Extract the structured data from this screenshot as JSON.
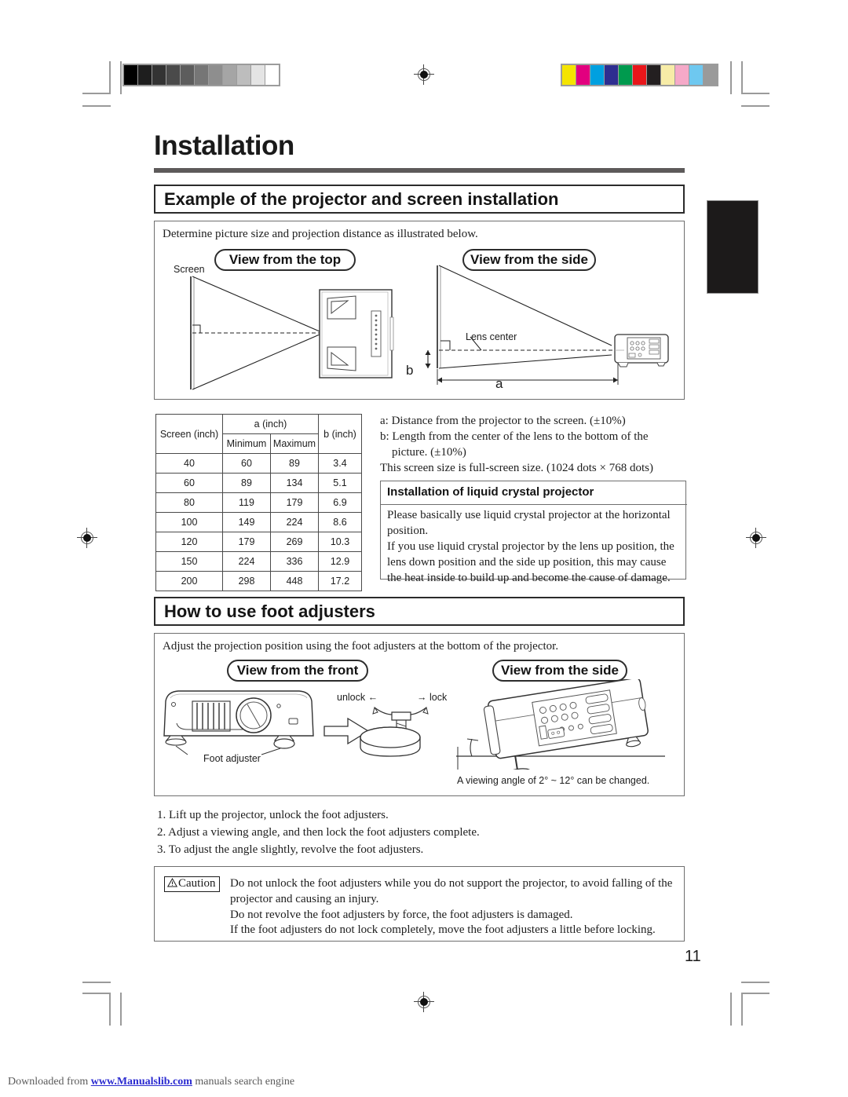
{
  "document": {
    "chapter_title": "Installation",
    "page_number": "11"
  },
  "sections": [
    {
      "id": "example-installation",
      "heading": "Example of the projector and screen installation",
      "intro": "Determine picture size and projection distance as illustrated below.",
      "captions": {
        "view_top": "View from the top",
        "view_side": "View from the side"
      },
      "diagram_labels": {
        "screen": "Screen",
        "lens_center": "Lens center",
        "dim_a": "a",
        "dim_b": "b"
      }
    },
    {
      "id": "foot-adjusters",
      "heading": "How to use foot adjusters",
      "intro": "Adjust the projection position using the foot adjusters at the bottom of the projector.",
      "captions": {
        "view_front": "View from the front",
        "view_side": "View from the side"
      },
      "diagram_labels": {
        "foot_adjuster": "Foot adjuster",
        "unlock": "unlock ←",
        "lock": "→ lock",
        "viewing_angle_note": "A viewing angle of 2° ~ 12° can be changed."
      },
      "steps": [
        "1. Lift up the projector, unlock the foot adjusters.",
        "2. Adjust a viewing angle, and then lock the foot adjusters complete.",
        "3. To adjust the angle slightly, revolve the foot adjusters."
      ]
    }
  ],
  "spec_table": {
    "header_group": "a (inch)",
    "columns": [
      "Screen (inch)",
      "Minimum",
      "Maximum",
      "b (inch)"
    ],
    "rows": [
      [
        "40",
        "60",
        "89",
        "3.4"
      ],
      [
        "60",
        "89",
        "134",
        "5.1"
      ],
      [
        "80",
        "119",
        "179",
        "6.9"
      ],
      [
        "100",
        "149",
        "224",
        "8.6"
      ],
      [
        "120",
        "179",
        "269",
        "10.3"
      ],
      [
        "150",
        "224",
        "336",
        "12.9"
      ],
      [
        "200",
        "298",
        "448",
        "17.2"
      ]
    ]
  },
  "legend_notes": [
    "a: Distance from the projector to the screen. (±10%)",
    "b: Length from the center of the lens to the bottom of the",
    "    picture. (±10%)",
    "This screen size is full-screen size. (1024 dots × 768 dots)"
  ],
  "lcd_box": {
    "heading": "Installation of liquid crystal projector",
    "paragraphs": [
      "Please basically use liquid crystal projector at the horizontal position.",
      "If you use liquid crystal projector by the lens up position, the lens down position and the side up position, this may cause the heat inside to build up and become the cause of damage."
    ]
  },
  "caution": {
    "badge": "Caution",
    "lines": [
      "Do not unlock the foot adjusters while you do not support the projector, to avoid falling of the",
      "projector and causing an injury.",
      "Do not revolve the foot adjusters by force, the foot adjusters is damaged.",
      "If the foot adjusters do not lock completely, move the foot adjusters a little before locking."
    ]
  },
  "footer": {
    "prefix": "Downloaded from ",
    "link": "www.Manualslib.com",
    "suffix": " manuals search engine"
  },
  "print_marks": {
    "gray_wedge": [
      "#000000",
      "#1e1e1e",
      "#333333",
      "#4a4a4a",
      "#5d5d5d",
      "#767676",
      "#8e8e8e",
      "#a5a5a5",
      "#bdbdbd",
      "#e4e4e4",
      "#ffffff"
    ],
    "color_bar": [
      "#f5e400",
      "#e2007f",
      "#00a0e0",
      "#2e2e90",
      "#009a4e",
      "#e8161a",
      "#231f20",
      "#f7eca7",
      "#f5a9c8",
      "#6ec8f0",
      "#9a9a9a"
    ],
    "tab_color": "#1c1a1a"
  }
}
